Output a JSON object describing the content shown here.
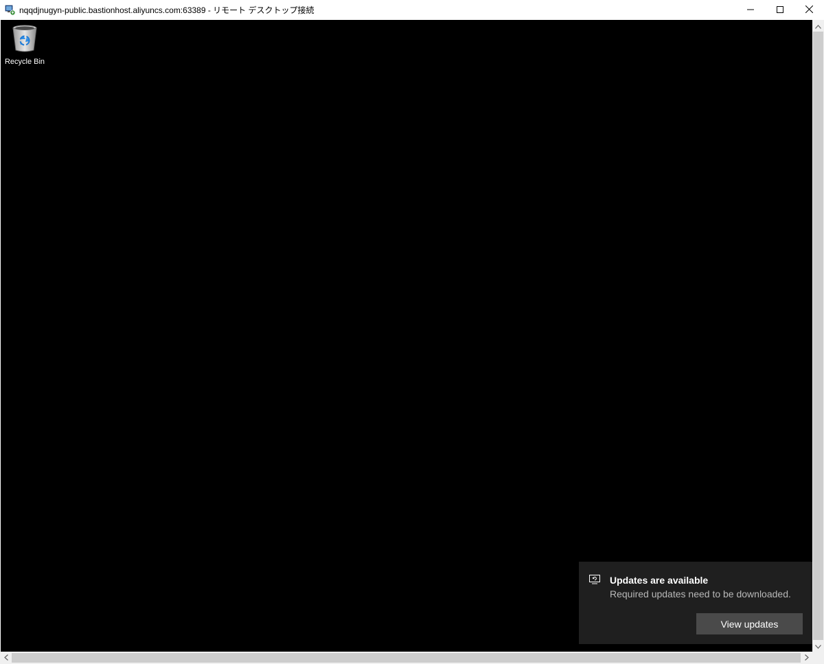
{
  "window": {
    "title": "nqqdjnugyn-public.bastionhost.aliyuncs.com:63389 - リモート デスクトップ接続",
    "icon": "remote-desktop-icon",
    "controls": {
      "minimize_icon": "minimize-icon",
      "maximize_icon": "maximize-icon",
      "close_icon": "close-icon"
    }
  },
  "desktop": {
    "background_color": "#000000",
    "icons": [
      {
        "label": "Recycle Bin",
        "icon": "recycle-bin-icon"
      }
    ]
  },
  "notification": {
    "icon": "windows-update-icon",
    "title": "Updates are available",
    "body": "Required updates need to be downloaded.",
    "button_label": "View updates",
    "background_color": "#1f1f1f",
    "button_color": "#4a4a4a"
  },
  "scrollbars": {
    "vertical": {
      "up_icon": "chevron-up-icon",
      "down_icon": "chevron-down-icon"
    },
    "horizontal": {
      "left_icon": "chevron-left-icon",
      "right_icon": "chevron-right-icon"
    }
  }
}
